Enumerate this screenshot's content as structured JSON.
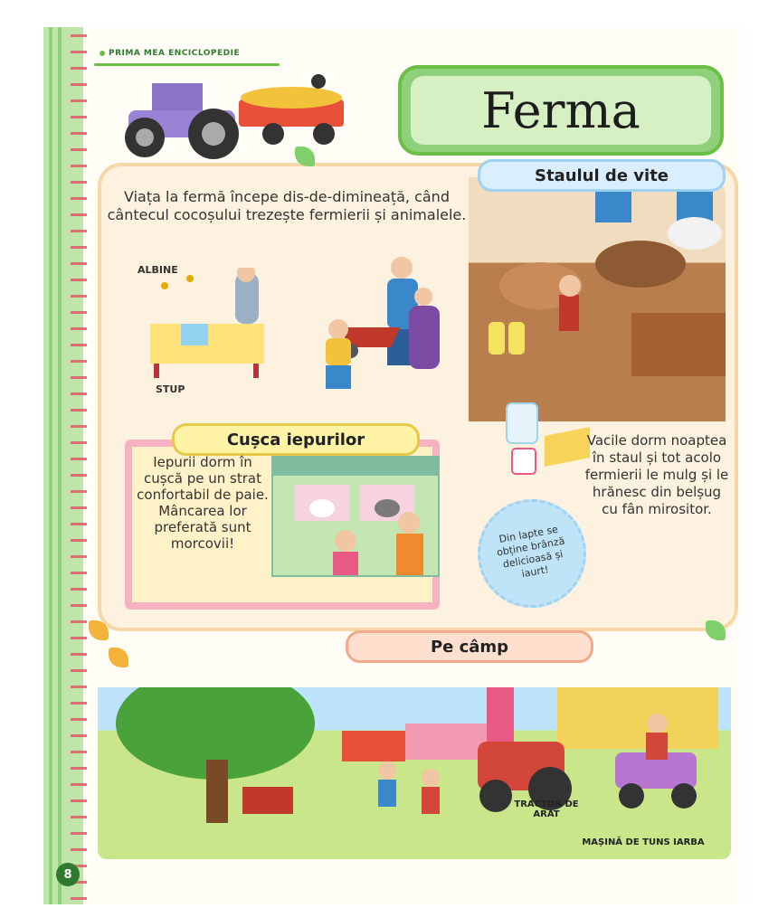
{
  "header": {
    "series": "PRIMA MEA ENCICLOPEDIE",
    "title": "Ferma"
  },
  "intro": "Viața la fermă începe dis-de-dimineață, când cântecul cocoșului trezește fermierii și animalele.",
  "beekeeping": {
    "label_bees": "ALBINE",
    "label_hive": "STUP"
  },
  "stall": {
    "heading": "Staulul de vite",
    "text": "Vacile dorm noaptea în staul și tot acolo fermierii le mulg și le hrănesc din belșug cu fân mirositor.",
    "bubble": "Din lapte se obține brânză delicioasă și iaurt!"
  },
  "rabbits": {
    "heading": "Cușca iepurilor",
    "text": "Iepurii dorm în cușcă pe un strat confortabil de paie. Mâncarea lor preferată sunt morcovii!"
  },
  "field": {
    "heading": "Pe câmp",
    "label_tractor": "TRACTOR DE ARAT",
    "label_mower": "MAȘINĂ DE TUNS IARBA"
  },
  "page_number": "8"
}
